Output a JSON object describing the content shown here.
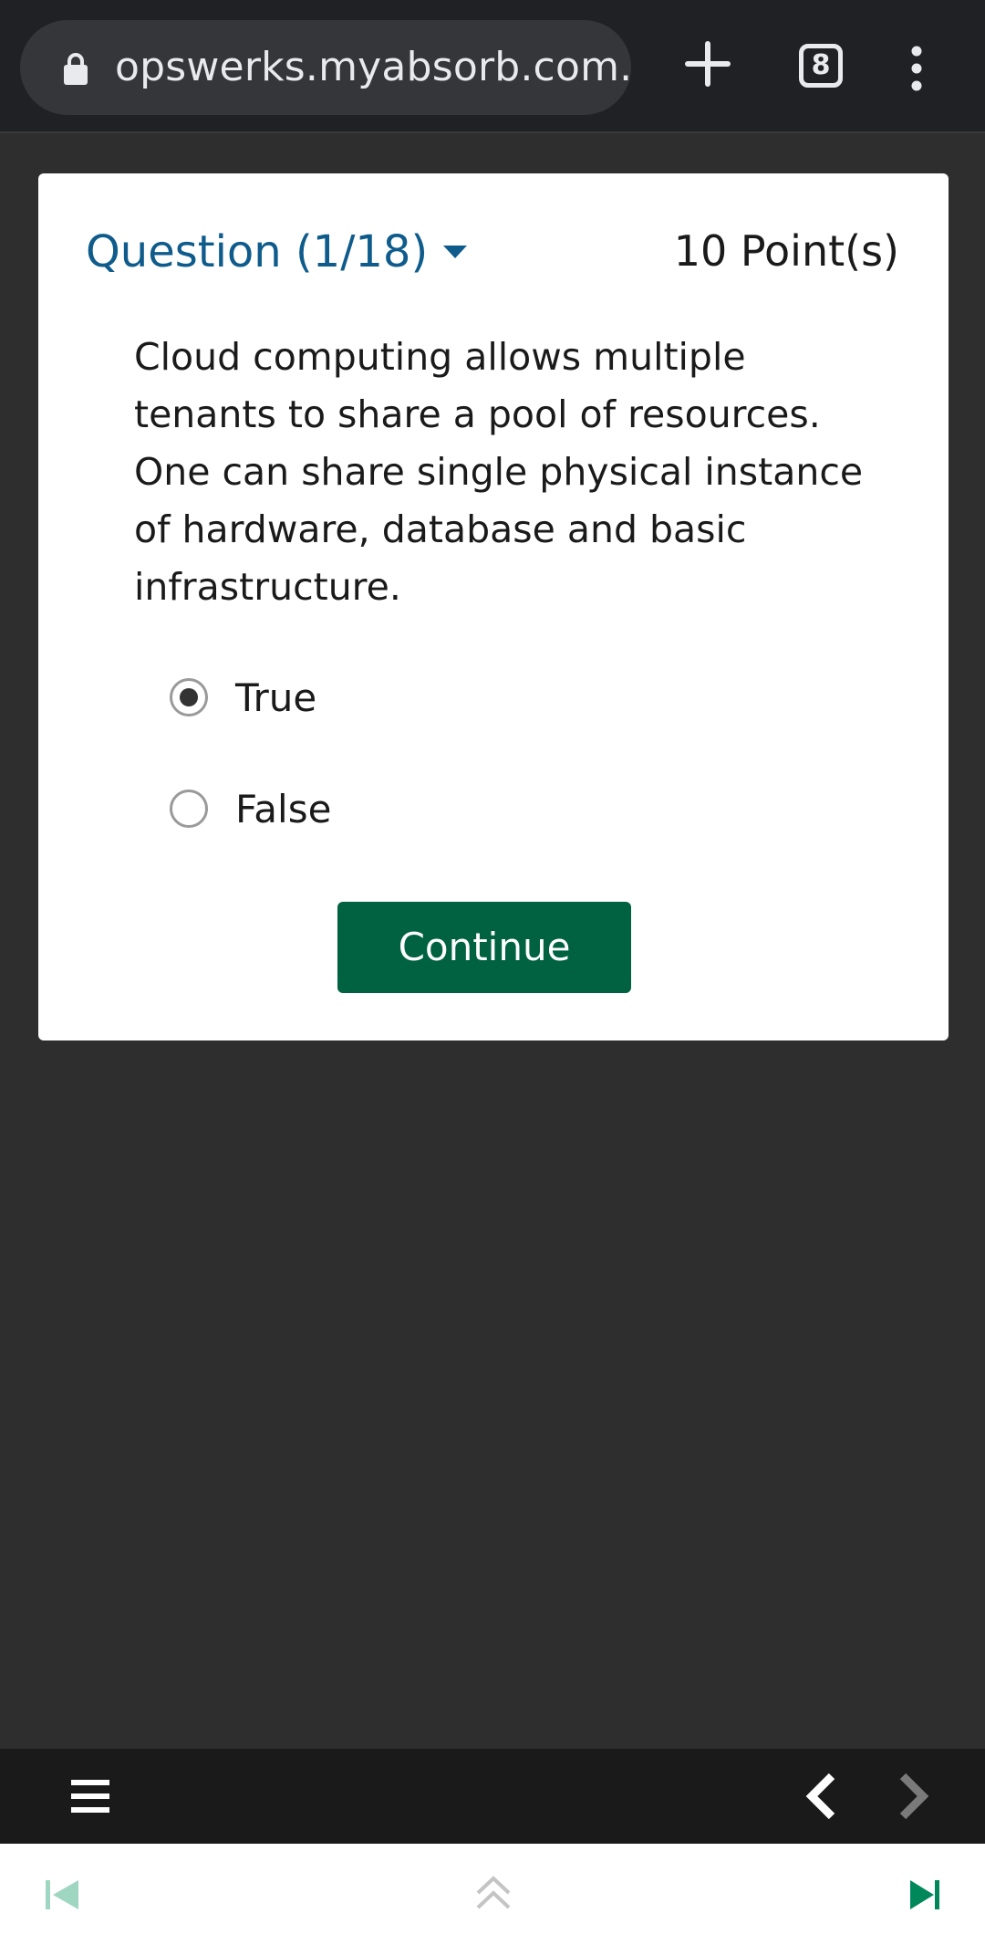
{
  "browser": {
    "url": "opswerks.myabsorb.com.au",
    "tab_count": "8"
  },
  "quiz": {
    "question_label": "Question (1/18)",
    "points": "10 Point(s)",
    "question_text": "Cloud computing allows multiple tenants to share a pool of resources. One can share single physical instance of hardware, database and basic infrastructure.",
    "options": [
      {
        "label": "True",
        "selected": true
      },
      {
        "label": "False",
        "selected": false
      }
    ],
    "continue_label": "Continue"
  },
  "colors": {
    "accent_blue": "#0f5c8c",
    "continue_green": "#006241",
    "nav_green": "#00875a",
    "nav_green_disabled": "#9fd6c2"
  },
  "icons": {
    "lock": "lock-icon",
    "new_tab": "plus-icon",
    "tabs": "tabs-icon",
    "menu": "more-vert-icon",
    "caret": "caret-down-icon",
    "hamburger": "hamburger-icon",
    "prev": "chevron-left-icon",
    "next": "chevron-right-icon",
    "skip_back": "skip-back-icon",
    "collapse": "double-chevron-up-icon",
    "skip_forward": "skip-forward-icon"
  }
}
